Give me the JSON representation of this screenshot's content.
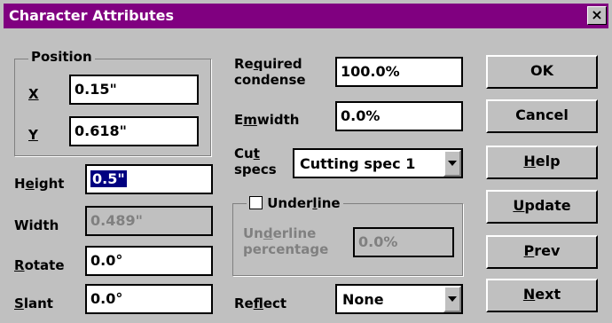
{
  "window": {
    "title": "Character Attributes",
    "close_glyph": "×"
  },
  "position": {
    "legend": "Position",
    "x_label": "X",
    "x_value": "0.15\"",
    "y_label": "Y",
    "y_value": "0.618\""
  },
  "height": {
    "label_pre": "H",
    "label_u": "e",
    "label_post": "ight",
    "value": "0.5\""
  },
  "width": {
    "label": "Width",
    "value": "0.489\""
  },
  "rotate": {
    "label_u": "R",
    "label_post": "otate",
    "value": "0.0°"
  },
  "slant": {
    "label_u": "S",
    "label_post": "lant",
    "value": "0.0°"
  },
  "required_condense": {
    "label1_pre": "Re",
    "label1_u": "q",
    "label1_post": "uired",
    "label2": "condense",
    "value": "100.0%"
  },
  "emwidth": {
    "label_pre": "E",
    "label_u": "m",
    "label_post": "width",
    "value": "0.0%"
  },
  "cut_specs": {
    "label1_pre": "Cu",
    "label1_u": "t",
    "label2": "specs",
    "value": "Cutting spec 1"
  },
  "underline": {
    "label_pre": "Under",
    "label_u": "l",
    "label_post": "ine",
    "checked": false,
    "pct_label1_pre": "Un",
    "pct_label1_u": "d",
    "pct_label1_post": "erline",
    "pct_label2": "percentage",
    "pct_value": "0.0%"
  },
  "reflect": {
    "label_pre": "Re",
    "label_u": "f",
    "label_post": "lect",
    "value": "None"
  },
  "buttons": {
    "ok": "OK",
    "cancel": "Cancel",
    "help_u": "H",
    "help_post": "elp",
    "update_u": "U",
    "update_post": "pdate",
    "prev_u": "P",
    "prev_post": "rev",
    "next_u": "N",
    "next_post": "ext"
  },
  "colors": {
    "title_bar": "#800080",
    "dialog_bg": "#c0c0c0",
    "selection": "#000080"
  }
}
